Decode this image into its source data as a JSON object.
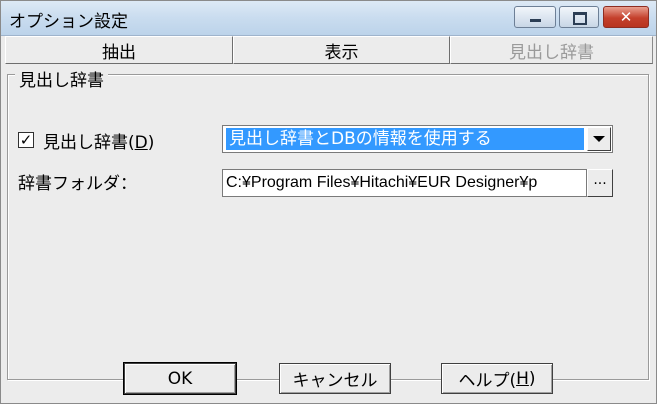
{
  "window": {
    "title": "オプション設定"
  },
  "tabs": [
    {
      "label": "抽出"
    },
    {
      "label": "表示"
    },
    {
      "label": "見出し辞書"
    }
  ],
  "group": {
    "legend": "見出し辞書"
  },
  "checkbox": {
    "checked": true,
    "mark": "✓",
    "label_pre": "見出し辞書(",
    "label_key": "D",
    "label_post": ")"
  },
  "combo": {
    "selected": "見出し辞書とDBの情報を使用する"
  },
  "folder": {
    "label": "辞書フォルダ：",
    "value": "C:¥Program Files¥Hitachi¥EUR Designer¥p",
    "browse_label": "..."
  },
  "buttons": {
    "ok": "OK",
    "cancel": "キャンセル",
    "help_pre": "ヘルプ(",
    "help_key": "H",
    "help_post": ")"
  },
  "colors": {
    "selection": "#3399ff",
    "close_button": "#c4402c"
  }
}
